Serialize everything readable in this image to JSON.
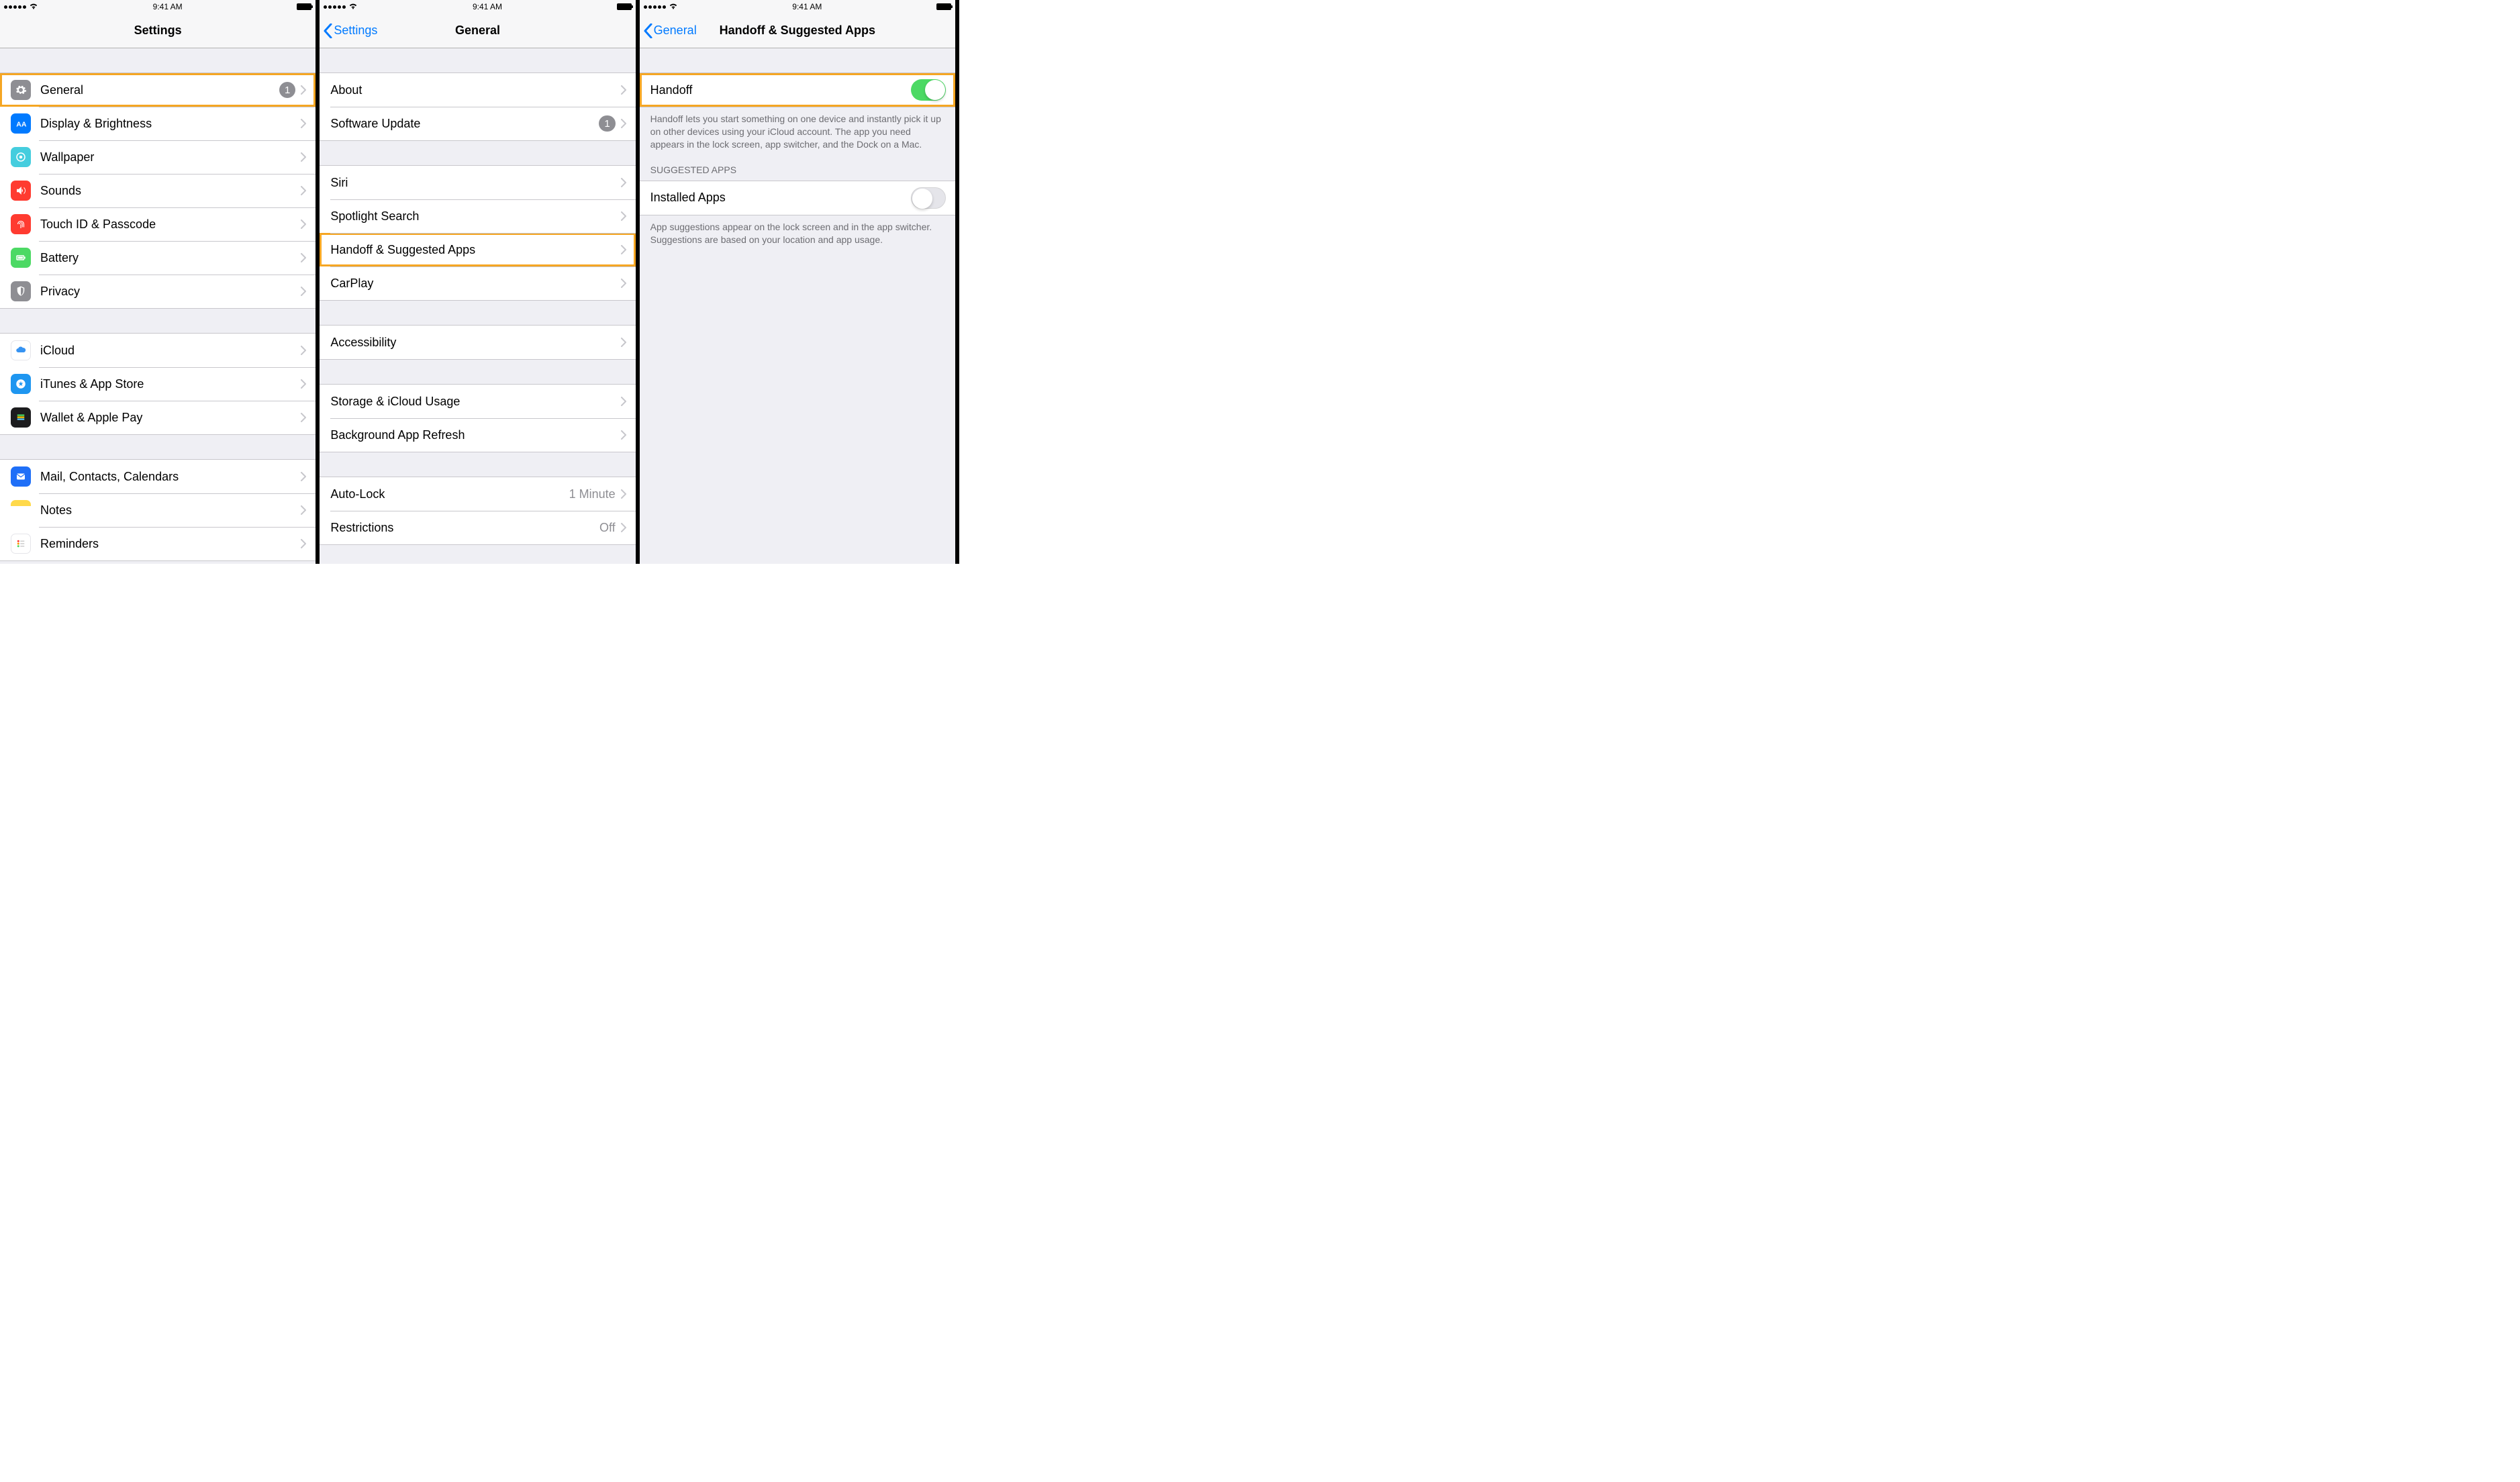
{
  "statusbar": {
    "time": "9:41 AM"
  },
  "screen1": {
    "title": "Settings",
    "groups": [
      [
        {
          "id": "general",
          "label": "General",
          "badge": "1",
          "highlight": true
        },
        {
          "id": "display",
          "label": "Display & Brightness"
        },
        {
          "id": "wallpaper",
          "label": "Wallpaper"
        },
        {
          "id": "sounds",
          "label": "Sounds"
        },
        {
          "id": "touchid",
          "label": "Touch ID & Passcode"
        },
        {
          "id": "battery",
          "label": "Battery"
        },
        {
          "id": "privacy",
          "label": "Privacy"
        }
      ],
      [
        {
          "id": "icloud",
          "label": "iCloud"
        },
        {
          "id": "itunes",
          "label": "iTunes & App Store"
        },
        {
          "id": "wallet",
          "label": "Wallet & Apple Pay"
        }
      ],
      [
        {
          "id": "mail",
          "label": "Mail, Contacts, Calendars"
        },
        {
          "id": "notes",
          "label": "Notes"
        },
        {
          "id": "reminders",
          "label": "Reminders"
        }
      ]
    ]
  },
  "screen2": {
    "back": "Settings",
    "title": "General",
    "groups": [
      [
        {
          "label": "About"
        },
        {
          "label": "Software Update",
          "badge": "1"
        }
      ],
      [
        {
          "label": "Siri"
        },
        {
          "label": "Spotlight Search"
        },
        {
          "label": "Handoff & Suggested Apps",
          "highlight": true
        },
        {
          "label": "CarPlay"
        }
      ],
      [
        {
          "label": "Accessibility"
        }
      ],
      [
        {
          "label": "Storage & iCloud Usage"
        },
        {
          "label": "Background App Refresh"
        }
      ],
      [
        {
          "label": "Auto-Lock",
          "value": "1 Minute"
        },
        {
          "label": "Restrictions",
          "value": "Off"
        }
      ]
    ]
  },
  "screen3": {
    "back": "General",
    "title": "Handoff & Suggested Apps",
    "handoff": {
      "label": "Handoff",
      "on": true,
      "highlight": true,
      "footer": "Handoff lets you start something on one device and instantly pick it up on other devices using your iCloud account. The app you need appears in the lock screen, app switcher, and the Dock on a Mac."
    },
    "suggested": {
      "header": "SUGGESTED APPS",
      "label": "Installed Apps",
      "on": false,
      "footer": "App suggestions appear on the lock screen and in the app switcher. Suggestions are based on your location and app usage."
    }
  }
}
